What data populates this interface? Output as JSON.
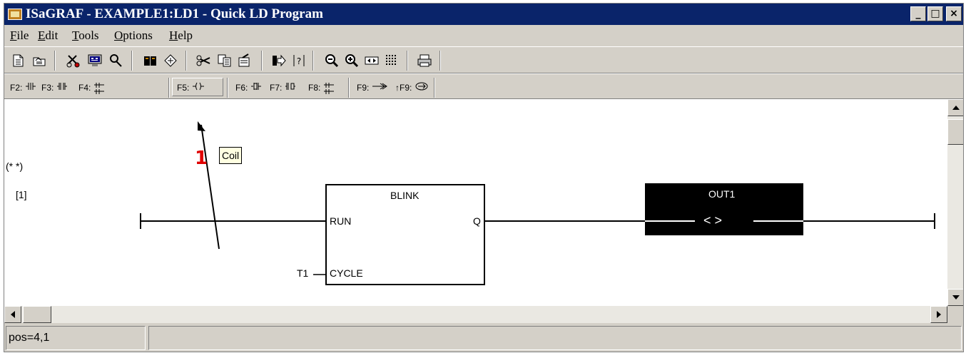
{
  "window": {
    "title": "ISaGRAF - EXAMPLE1:LD1 - Quick LD Program",
    "controls": {
      "minimize": "_",
      "maximize": "□",
      "close": "×"
    }
  },
  "menu": {
    "items": [
      {
        "label": "File"
      },
      {
        "label": "Edit"
      },
      {
        "label": "Tools"
      },
      {
        "label": "Options"
      },
      {
        "label": "Help"
      }
    ]
  },
  "toolbar": {
    "icons": [
      "new-icon",
      "open-icon",
      "cut-red-icon",
      "monitor-icon",
      "search-icon",
      "dictionary-icon",
      "variables-icon",
      "cut-icon",
      "copy-icon",
      "paste-icon",
      "goto-icon",
      "find-icon",
      "zoom-out-icon",
      "zoom-in-icon",
      "resize-icon",
      "grid-icon",
      "print-icon"
    ]
  },
  "fkeys": {
    "f2": "F2:",
    "f3": "F3:",
    "f4": "F4:",
    "f5": "F5:",
    "f6": "F6:",
    "f7": "F7:",
    "f8": "F8:",
    "f9": "F9:",
    "sf9": "↑F9:"
  },
  "ladder": {
    "comment": "(* *)",
    "rung_number": "[1]",
    "block": {
      "name": "BLINK",
      "input1": "RUN",
      "input2": "CYCLE",
      "output": "Q"
    },
    "cycle_var": "T1",
    "coil": {
      "var": "OUT1",
      "symbol": "<  >"
    }
  },
  "tooltip": {
    "text": "Coil"
  },
  "callout": {
    "number": "1"
  },
  "status": {
    "pos": "pos=4,1"
  },
  "colors": {
    "title_bg": "#0a246a",
    "callout": "#e00000",
    "tooltip_bg": "#ffffe1",
    "coil_bg": "#000000"
  }
}
